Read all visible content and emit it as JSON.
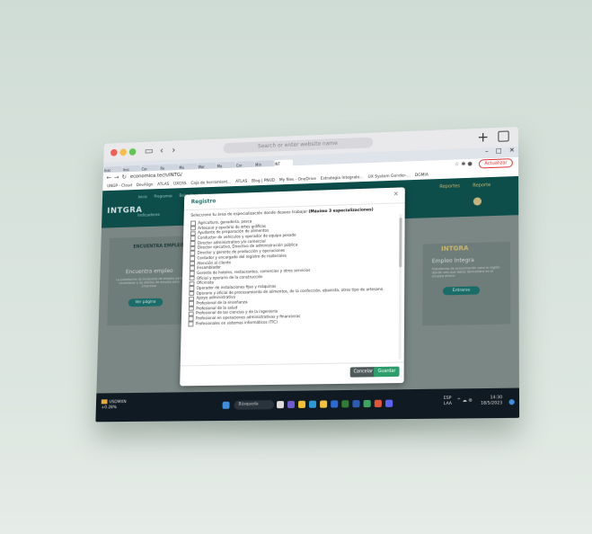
{
  "mac": {
    "url_placeholder": "Search or enter website name",
    "plus": "+"
  },
  "browser": {
    "tabs": [
      "Insc",
      "Insc",
      "Cor",
      "Re",
      "Mo",
      "Wor",
      "Mo",
      "Cor",
      "Min",
      "INT"
    ],
    "address": "economica.tech/INTG/",
    "action_button": "Actualizar",
    "bookmarks": [
      "UNGP - Cloud",
      "DevAlign",
      "ATLAS",
      "UXGSS",
      "Caja de herramient...",
      "ATLAS",
      "Blog | PNUD",
      "My files - OneDrive",
      "Estrategia Integrate...",
      "UX System Gender-...",
      "DGMIA"
    ]
  },
  "site": {
    "logo": "INTGRA",
    "top_links": [
      "Inicio",
      "Programas",
      "Bolsa de empleo"
    ],
    "indicator": "Indicadores",
    "right_links": [
      "Reportes",
      "Reporte"
    ],
    "left_card": {
      "brand": "ENCUENTRA EMPLEO",
      "title": "Encuentra empleo",
      "desc": "La plataforma de busqueda de empleo para candidatos y de ofertas de empleo para empresas",
      "button": "Ver página"
    },
    "right_card": {
      "brand": "INTGRA",
      "title": "Empleo Integra",
      "desc": "Plataforma de presentación para la región donde veo que datos demuestra en el empleo ofrece",
      "button": "Entrarse"
    }
  },
  "modal": {
    "title": "Registro",
    "close": "×",
    "question": "Seleccione tu área de especialización donde desees trabajar",
    "question_bold": "(Máximo 3 especializaciones)",
    "options": [
      "Agricultura, ganadería, pesca",
      "Artesano y operario de artes gráficas",
      "Ayudante de preparación de alimentos",
      "Conductor de vehículos y operador de equipo pesado",
      "Director administrativo y/o comercial",
      "Director ejecutivo, Directivo de administración pública",
      "Director y gerente de producción y operaciones",
      "Contador y encargado del registro de materiales",
      "Atención al cliente",
      "Ensamblador",
      "Gerente de hoteles, restaurantes, comercios y otros servicios",
      "Oficial y operario de la construcción",
      "Oficinista",
      "Operador de instalaciones fijas y máquinas",
      "Operario y oficial de procesamiento de alimentos, de la confección, ebanista, otros tipo de artesano",
      "Apoyo administrativo",
      "Profesional de la enseñanza",
      "Profesional de la salud",
      "Profesional de las ciencias y de la ingeniería",
      "Profesional en operaciones administrativas y financieras",
      "Profesionales en sistemas informáticos (TIC)"
    ],
    "cancel": "Cancelar",
    "save": "Guardar"
  },
  "taskbar": {
    "weather_name": "USDMXN",
    "weather_change": "+0.28%",
    "search": "Búsqueda",
    "lang1": "ESP",
    "lang2": "LAA",
    "time": "14:30",
    "date": "18/5/2023"
  }
}
